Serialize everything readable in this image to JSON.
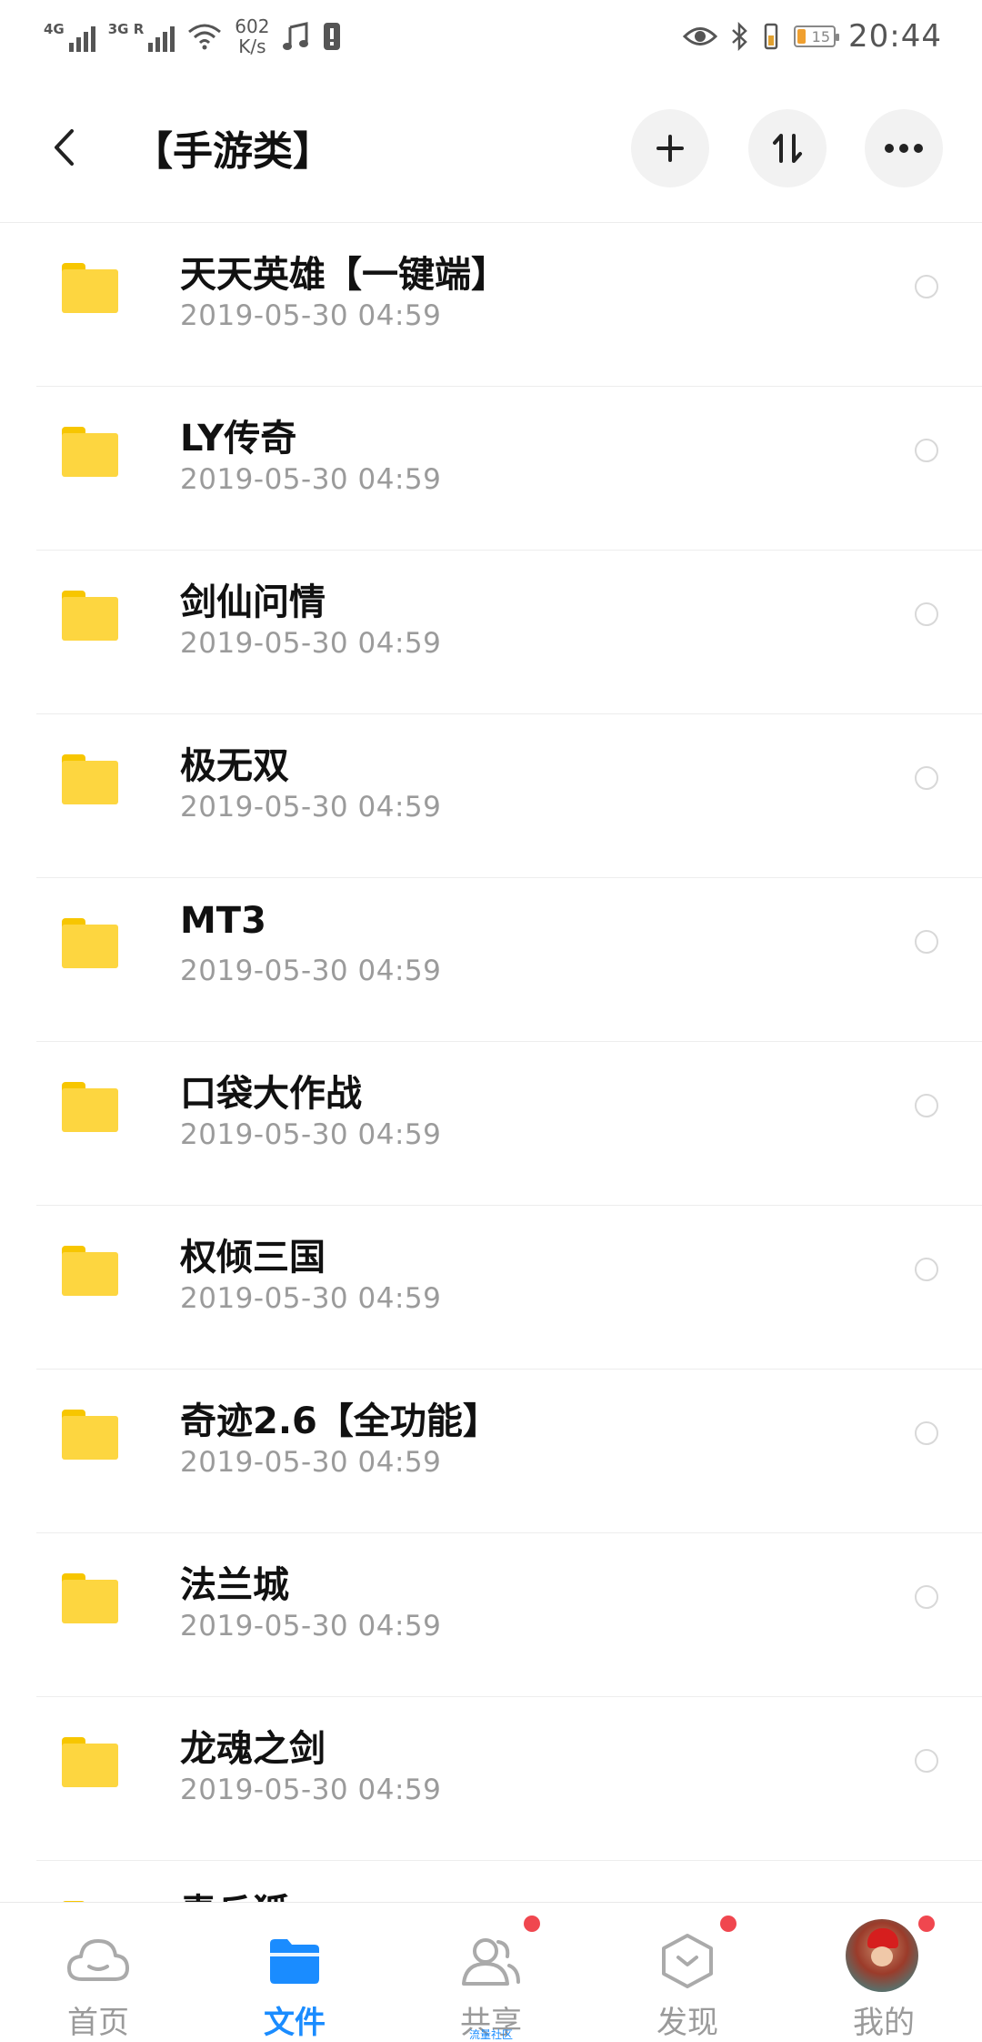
{
  "status_bar": {
    "net1": "4G",
    "net2": "3G R",
    "speed_value": "602",
    "speed_unit": "K/s",
    "battery": "15",
    "time": "20:44"
  },
  "header": {
    "title": "【手游类】"
  },
  "files": [
    {
      "name": "天天英雄【一键端】",
      "date": "2019-05-30  04:59"
    },
    {
      "name": "LY传奇",
      "date": "2019-05-30  04:59"
    },
    {
      "name": "剑仙问情",
      "date": "2019-05-30  04:59"
    },
    {
      "name": "极无双",
      "date": "2019-05-30  04:59"
    },
    {
      "name": "MT3",
      "date": "2019-05-30  04:59"
    },
    {
      "name": "口袋大作战",
      "date": "2019-05-30  04:59"
    },
    {
      "name": "权倾三国",
      "date": "2019-05-30  04:59"
    },
    {
      "name": "奇迹2.6【全功能】",
      "date": "2019-05-30  04:59"
    },
    {
      "name": "法兰城",
      "date": "2019-05-30  04:59"
    },
    {
      "name": "龙魂之剑",
      "date": "2019-05-30  04:59"
    },
    {
      "name": "青丘狐",
      "date": ""
    }
  ],
  "tabbar": {
    "items": [
      {
        "label": "首页",
        "icon": "cloud-icon"
      },
      {
        "label": "文件",
        "icon": "folder-icon"
      },
      {
        "label": "共享",
        "icon": "people-icon",
        "sublabel": "流量社区"
      },
      {
        "label": "发现",
        "icon": "discover-icon"
      },
      {
        "label": "我的",
        "icon": "avatar"
      }
    ]
  },
  "colors": {
    "accent": "#1a8cff",
    "folder": "#fdd640",
    "badge": "#f0474f"
  }
}
